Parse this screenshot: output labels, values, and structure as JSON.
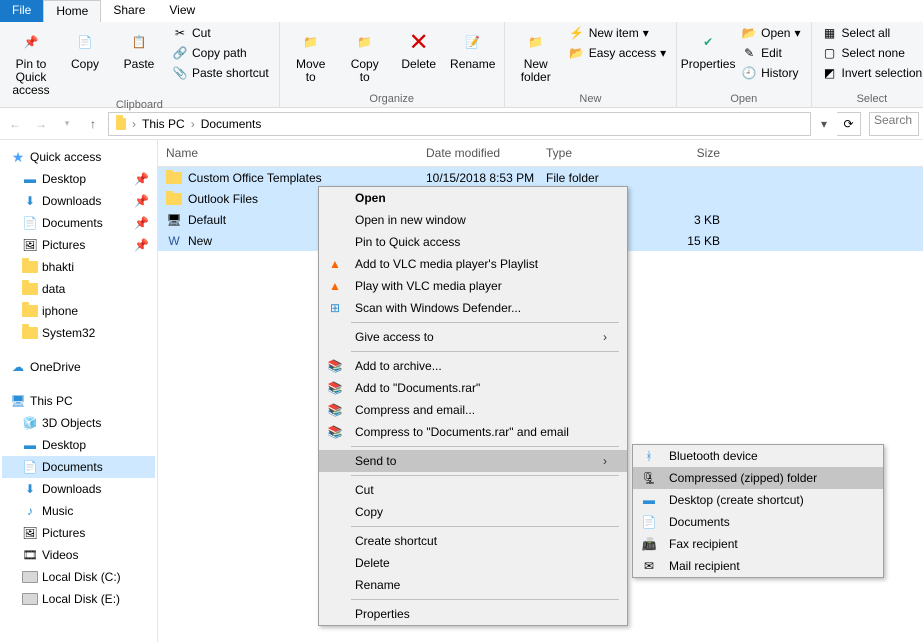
{
  "tabs": {
    "file": "File",
    "home": "Home",
    "share": "Share",
    "view": "View"
  },
  "ribbon": {
    "groups": {
      "clipboard": {
        "label": "Clipboard",
        "pin": "Pin to Quick\naccess",
        "copy": "Copy",
        "paste": "Paste",
        "cut": "Cut",
        "copy_path": "Copy path",
        "paste_shortcut": "Paste shortcut"
      },
      "organize": {
        "label": "Organize",
        "move_to": "Move\nto",
        "copy_to": "Copy\nto",
        "delete": "Delete",
        "rename": "Rename"
      },
      "new": {
        "label": "New",
        "new_folder": "New\nfolder",
        "new_item": "New item",
        "easy_access": "Easy access"
      },
      "open": {
        "label": "Open",
        "properties": "Properties",
        "open": "Open",
        "edit": "Edit",
        "history": "History"
      },
      "select": {
        "label": "Select",
        "select_all": "Select all",
        "select_none": "Select none",
        "invert": "Invert selection"
      }
    }
  },
  "breadcrumbs": {
    "pc": "This PC",
    "docs": "Documents"
  },
  "search_placeholder": "Search",
  "nav": {
    "quick_access": "Quick access",
    "desktop": "Desktop",
    "downloads": "Downloads",
    "documents": "Documents",
    "pictures": "Pictures",
    "bhakti": "bhakti",
    "data": "data",
    "iphone": "iphone",
    "system32": "System32",
    "onedrive": "OneDrive",
    "this_pc": "This PC",
    "objects3d": "3D Objects",
    "music": "Music",
    "videos": "Videos",
    "local_c": "Local Disk (C:)",
    "local_e": "Local Disk (E:)"
  },
  "columns": {
    "name": "Name",
    "date": "Date modified",
    "type": "Type",
    "size": "Size"
  },
  "files": [
    {
      "name": "Custom Office Templates",
      "date": "10/15/2018 8:53 PM",
      "type": "File folder",
      "size": ""
    },
    {
      "name": "Outlook Files",
      "date": "",
      "type": "",
      "size": ""
    },
    {
      "name": "Default",
      "date": "",
      "type": "",
      "size": "3 KB"
    },
    {
      "name": "New",
      "date": "",
      "type": "",
      "size": "15 KB"
    }
  ],
  "ctx1": {
    "open": "Open",
    "open_new": "Open in new window",
    "pin_qa": "Pin to Quick access",
    "vlc_playlist": "Add to VLC media player's Playlist",
    "vlc_play": "Play with VLC media player",
    "defender": "Scan with Windows Defender...",
    "give_access": "Give access to",
    "add_archive": "Add to archive...",
    "add_docs_rar": "Add to \"Documents.rar\"",
    "compress_email": "Compress and email...",
    "compress_docs_email": "Compress to \"Documents.rar\" and email",
    "send_to": "Send to",
    "cut": "Cut",
    "copy": "Copy",
    "create_shortcut": "Create shortcut",
    "delete": "Delete",
    "rename": "Rename",
    "properties": "Properties"
  },
  "ctx2": {
    "bluetooth": "Bluetooth device",
    "zipped": "Compressed (zipped) folder",
    "desktop_shortcut": "Desktop (create shortcut)",
    "documents": "Documents",
    "fax": "Fax recipient",
    "mail": "Mail recipient"
  }
}
